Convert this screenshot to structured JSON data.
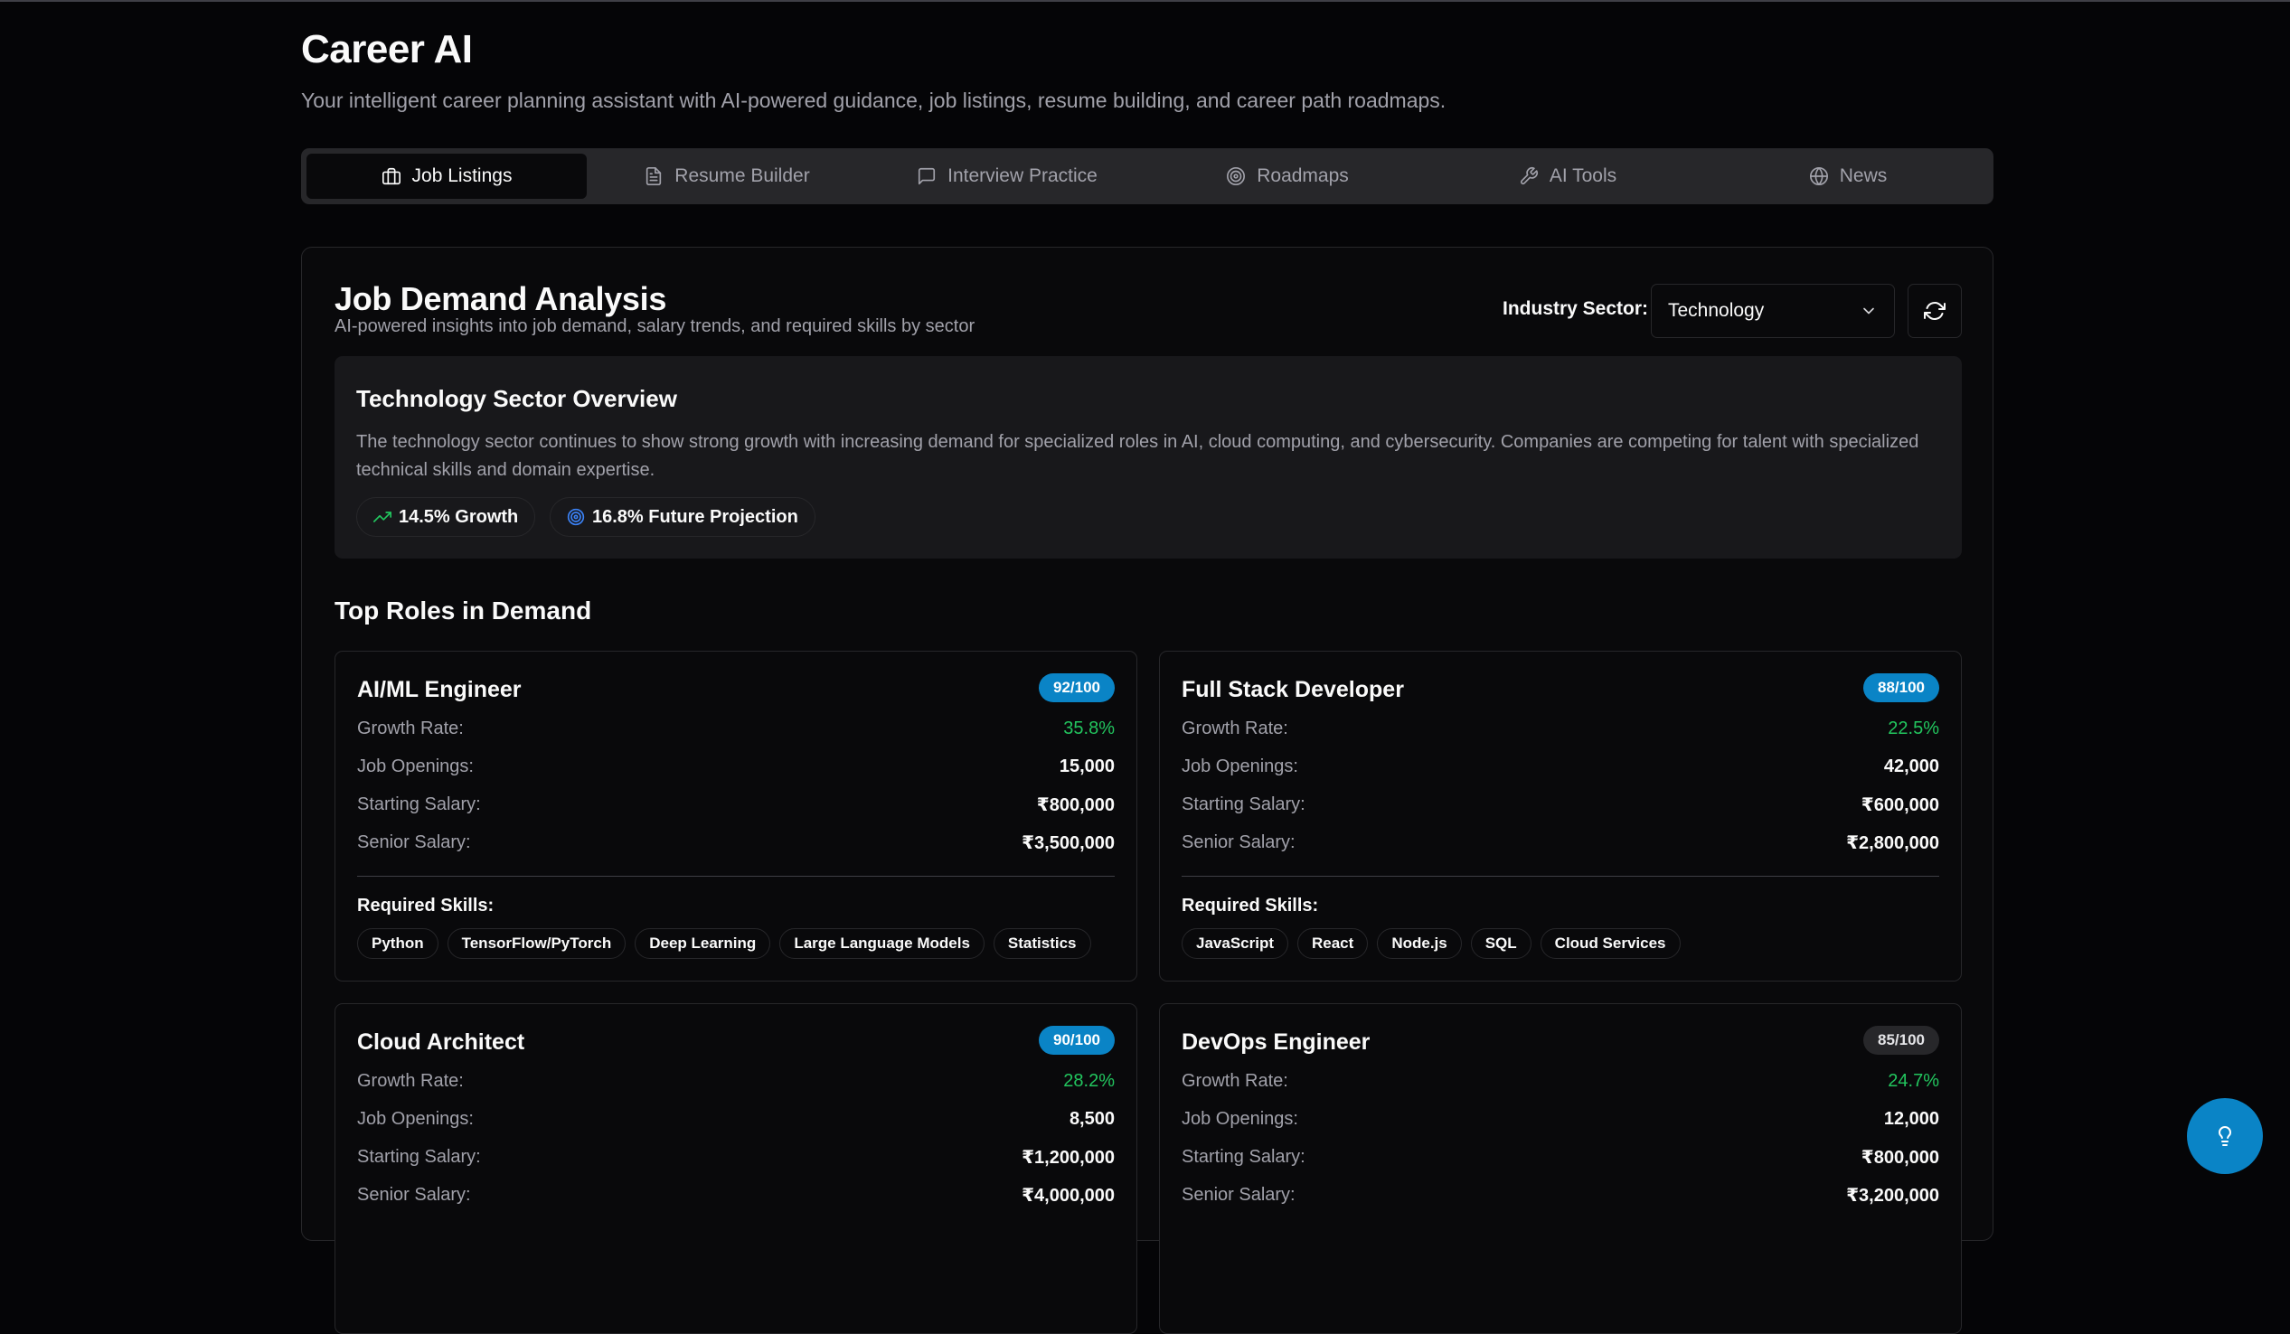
{
  "app": {
    "title": "Career AI",
    "subtitle": "Your intelligent career planning assistant with AI-powered guidance, job listings, resume building, and career path roadmaps."
  },
  "tabs": [
    {
      "label": "Job Listings",
      "icon": "briefcase-icon",
      "active": true
    },
    {
      "label": "Resume Builder",
      "icon": "file-text-icon",
      "active": false
    },
    {
      "label": "Interview Practice",
      "icon": "message-square-icon",
      "active": false
    },
    {
      "label": "Roadmaps",
      "icon": "target-icon",
      "active": false
    },
    {
      "label": "AI Tools",
      "icon": "wrench-icon",
      "active": false
    },
    {
      "label": "News",
      "icon": "globe-icon",
      "active": false
    }
  ],
  "analysis": {
    "title": "Job Demand Analysis",
    "subtitle": "AI-powered insights into job demand, salary trends, and required skills by sector",
    "sector_label": "Industry Sector:",
    "sector_value": "Technology"
  },
  "overview": {
    "title": "Technology Sector Overview",
    "text": "The technology sector continues to show strong growth with increasing demand for specialized roles in AI, cloud computing, and cybersecurity. Companies are competing for talent with specialized technical skills and domain expertise.",
    "growth": "14.5% Growth",
    "projection": "16.8% Future Projection"
  },
  "roles_title": "Top Roles in Demand",
  "labels": {
    "growth": "Growth Rate:",
    "openings": "Job Openings:",
    "starting": "Starting Salary:",
    "senior": "Senior Salary:",
    "skills": "Required Skills:"
  },
  "roles": [
    {
      "name": "AI/ML Engineer",
      "score": "92/100",
      "growth": "35.8%",
      "openings": "15,000",
      "starting": "₹800,000",
      "senior": "₹3,500,000",
      "skills": [
        "Python",
        "TensorFlow/PyTorch",
        "Deep Learning",
        "Large Language Models",
        "Statistics"
      ]
    },
    {
      "name": "Full Stack Developer",
      "score": "88/100",
      "growth": "22.5%",
      "openings": "42,000",
      "starting": "₹600,000",
      "senior": "₹2,800,000",
      "skills": [
        "JavaScript",
        "React",
        "Node.js",
        "SQL",
        "Cloud Services"
      ]
    },
    {
      "name": "Cloud Architect",
      "score": "90/100",
      "growth": "28.2%",
      "openings": "8,500",
      "starting": "₹1,200,000",
      "senior": "₹4,000,000",
      "skills": []
    },
    {
      "name": "DevOps Engineer",
      "score": "85/100",
      "growth": "24.7%",
      "openings": "12,000",
      "starting": "₹800,000",
      "senior": "₹3,200,000",
      "skills": []
    }
  ],
  "colors": {
    "accent": "#0a84c6",
    "growth_green": "#22c55e",
    "background": "#050507"
  }
}
